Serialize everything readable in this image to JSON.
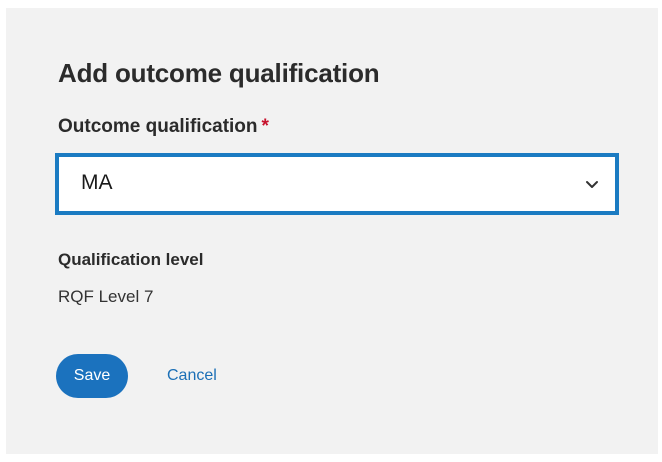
{
  "form": {
    "title": "Add outcome qualification",
    "field_label": "Outcome qualification",
    "required_marker": "*",
    "selected_value": "MA",
    "info_label": "Qualification level",
    "info_value": "RQF Level 7",
    "save_label": "Save",
    "cancel_label": "Cancel"
  },
  "icons": {
    "dropdown": "chevron-down-icon"
  },
  "colors": {
    "panel_background": "#f2f2f2",
    "accent": "#1b7bc2",
    "required": "#c7112c",
    "text": "#2b2b2b"
  }
}
